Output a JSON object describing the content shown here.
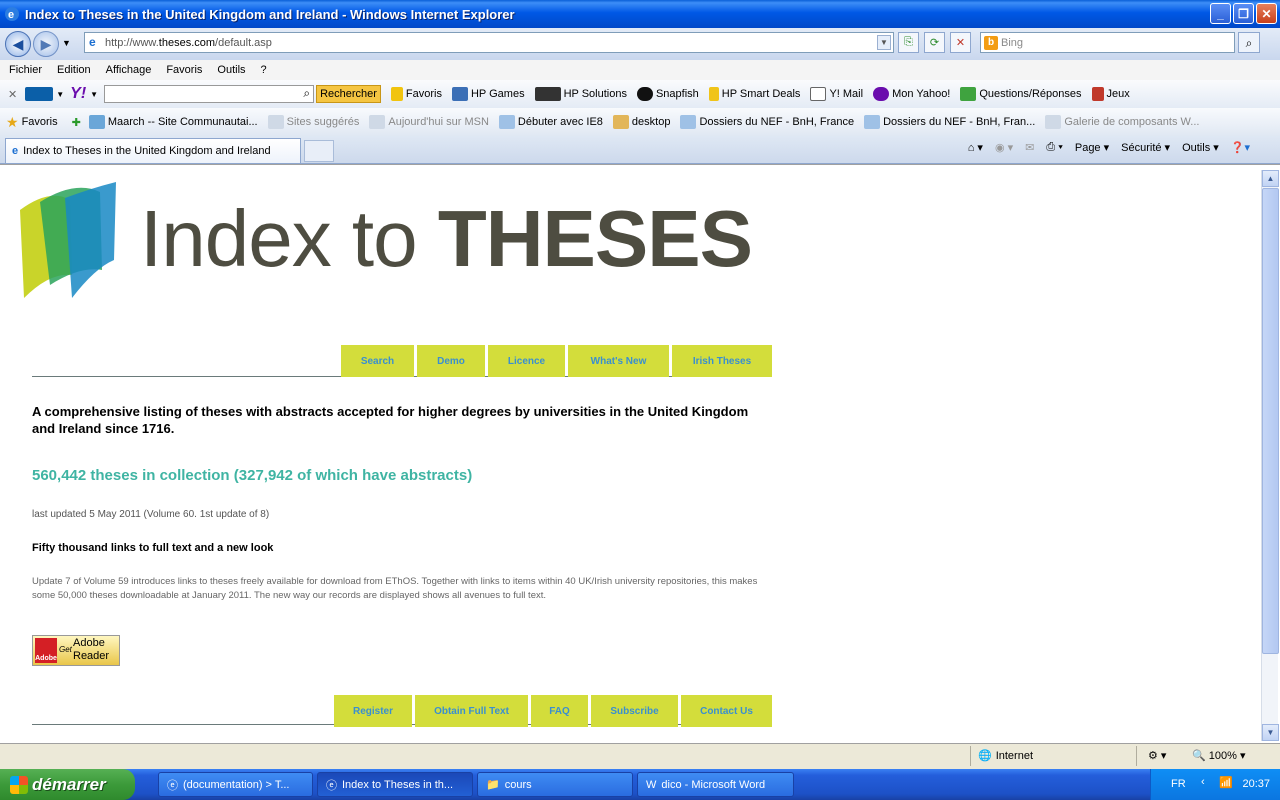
{
  "window": {
    "title": "Index to Theses in the United Kingdom and Ireland - Windows Internet Explorer"
  },
  "address": {
    "prefix": "http://www.",
    "domain": "theses.com",
    "path": "/default.asp"
  },
  "search": {
    "placeholder": "Bing"
  },
  "menu": [
    "Fichier",
    "Edition",
    "Affichage",
    "Favoris",
    "Outils",
    "?"
  ],
  "toolbar1": {
    "search_button": "Rechercher",
    "favoris": "Favoris",
    "items": [
      "HP Games",
      "HP Solutions",
      "Snapfish",
      "HP Smart Deals",
      "Y! Mail",
      "Mon Yahoo!",
      "Questions/Réponses",
      "Jeux"
    ]
  },
  "favbar": {
    "favoris": "Favoris",
    "items": [
      "Maarch -- Site Communautai...",
      "Sites suggérés",
      "Aujourd'hui sur MSN",
      "Débuter avec IE8",
      "desktop",
      "Dossiers du NEF - BnH, France",
      "Dossiers du NEF - BnH, Fran...",
      "Galerie de composants W..."
    ]
  },
  "tab": {
    "title": "Index to Theses in the United Kingdom and Ireland"
  },
  "commandbar": {
    "page": "Page",
    "securite": "Sécurité",
    "outils": "Outils"
  },
  "page": {
    "logo_light": "Index to ",
    "logo_bold": "THESES",
    "top_nav": [
      "Search",
      "Demo",
      "Licence",
      "What's New",
      "Irish Theses"
    ],
    "lead": "A comprehensive listing of theses with abstracts accepted for higher degrees by universities in the United Kingdom and Ireland since 1716.",
    "stat": "560,442 theses in collection (327,942 of which have abstracts)",
    "updated": "last updated 5 May 2011 (Volume 60. 1st update of 8)",
    "news_head": "Fifty thousand links to full text and a new look",
    "news_body": "Update 7 of Volume 59 introduces links to theses freely available for download from EThOS. Together with links to items within 40 UK/Irish university repositories, this makes some 50,000 theses downloadable at January 2011. The new way our records are displayed shows all avenues to full text.",
    "adobe": {
      "get": "Get",
      "line1": "Adobe",
      "line2": "Reader",
      "brand": "Adobe"
    },
    "bottom_nav": [
      "Register",
      "Obtain Full Text",
      "FAQ",
      "Subscribe",
      "Contact Us"
    ]
  },
  "status": {
    "zone": "Internet",
    "zoom": "100%"
  },
  "taskbar": {
    "start": "démarrer",
    "buttons": [
      "(documentation) > T...",
      "Index to Theses in th...",
      "cours",
      "dico - Microsoft Word"
    ],
    "lang": "FR",
    "clock": "20:37"
  },
  "colors": {
    "nav_bg": "#d3dd3b",
    "nav_text": "#3a8fd0",
    "stat": "#3fb4a3",
    "logo_text": "#4e4d41"
  }
}
